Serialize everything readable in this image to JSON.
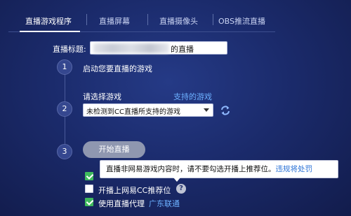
{
  "tabs": [
    {
      "label": "直播游戏程序",
      "active": true
    },
    {
      "label": "直播屏幕",
      "active": false
    },
    {
      "label": "直播摄像头",
      "active": false
    },
    {
      "label": "OBS推流直播",
      "active": false
    }
  ],
  "title_field": {
    "label": "直播标题:",
    "value_suffix": "的直播"
  },
  "steps": {
    "step1": {
      "number": "1",
      "label": "启动您要直播的游戏"
    },
    "step2": {
      "number": "2",
      "label": "请选择游戏",
      "supported_link": "支持的游戏",
      "select_value": "未检测到CC直播所支持的游戏"
    },
    "step3": {
      "number": "3",
      "button": "开始直播"
    }
  },
  "tooltip": {
    "text": "直播非网易游戏内容时，请不要勾选开播上推荐位。",
    "link": "违规将处罚"
  },
  "options": [
    {
      "label": "开播上网易CC推荐位",
      "checked": false,
      "icon": "help-icon"
    },
    {
      "label": "使用直播代理",
      "checked": true,
      "link": "广东联通"
    }
  ],
  "colors": {
    "accent_link": "#6cb0ff",
    "check_green": "#3fba5d",
    "background": "#1b2b6c"
  }
}
